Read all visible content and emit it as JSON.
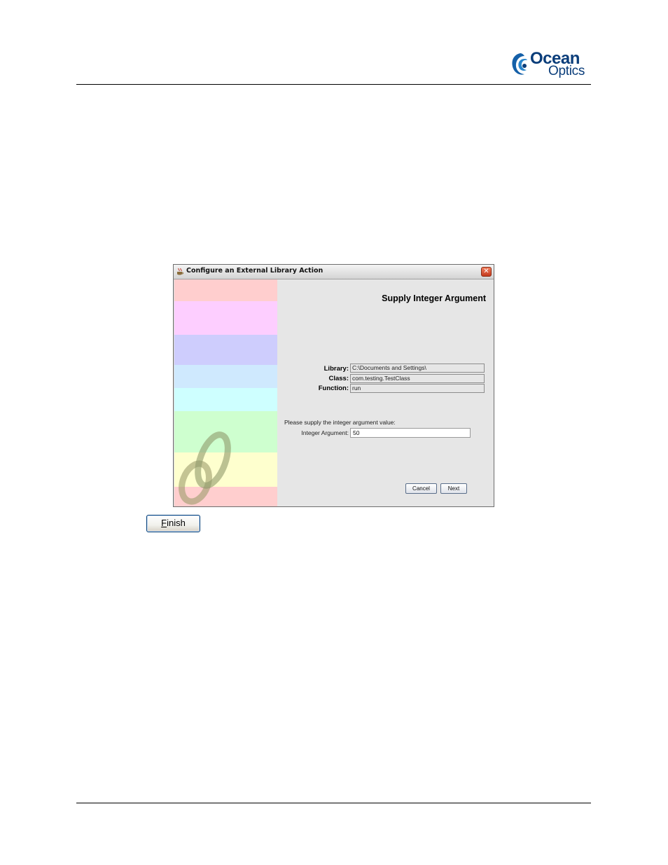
{
  "header": {
    "logo": {
      "line1": "Ocean",
      "line2": "Optics",
      "color": "#0a3d7a"
    }
  },
  "dialog": {
    "title": "Configure an External Library Action",
    "heading": "Supply Integer Argument",
    "fields": {
      "library_label": "Library:",
      "library_value": "C:\\Documents and Settings\\",
      "class_label": "Class:",
      "class_value": "com.testing.TestClass",
      "function_label": "Function:",
      "function_value": "run"
    },
    "prompt": "Please supply the integer argument value:",
    "integer_label": "Integer Argument:",
    "integer_value": "50",
    "buttons": {
      "cancel": "Cancel",
      "next": "Next"
    },
    "side_band_colors": [
      "#ffcece",
      "#fdceff",
      "#cecdfd",
      "#cfe9fe",
      "#ceffff",
      "#ceffcf",
      "#feffce",
      "#ffcece"
    ]
  },
  "finish_button": {
    "first_letter": "F",
    "rest": "inish"
  }
}
